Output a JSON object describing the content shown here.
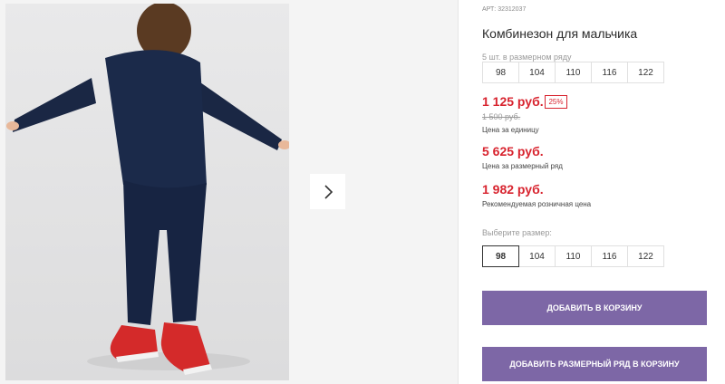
{
  "product": {
    "article": "АРТ: 32312037",
    "title": "Комбинезон для мальчика",
    "pack_note": "5 шт. в размерном ряду",
    "pack_sizes": [
      "98",
      "104",
      "110",
      "116",
      "122"
    ],
    "unit_price": "1 125 руб.",
    "discount": "25%",
    "old_price": "1 500 руб.",
    "unit_price_caption": "Цена за единицу",
    "pack_price": "5 625 руб.",
    "pack_price_caption": "Цена за размерный ряд",
    "retail_price": "1 982 руб.",
    "retail_price_caption": "Рекомендуемая розничная цена",
    "choose_label": "Выберите размер:",
    "sizes": [
      "98",
      "104",
      "110",
      "116",
      "122"
    ],
    "selected_size": "98"
  },
  "buttons": {
    "add_to_cart": "ДОБАВИТЬ В КОРЗИНУ",
    "add_pack_to_cart": "ДОБАВИТЬ РАЗМЕРНЫЙ РЯД В КОРЗИНУ"
  },
  "icons": {
    "next": "chevron-right-icon"
  },
  "colors": {
    "price_red": "#d8242f",
    "button_purple": "#7d67a6"
  }
}
